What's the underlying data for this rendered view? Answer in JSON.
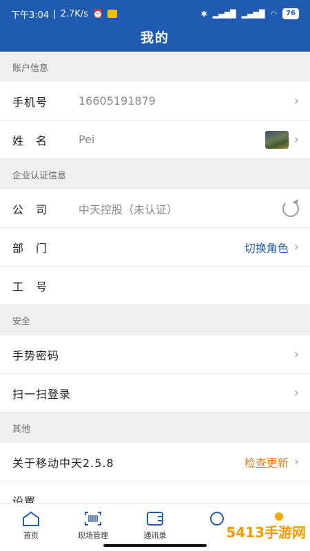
{
  "status_bar": {
    "time": "下午3:04",
    "speed": "2.7K/s",
    "battery": "76"
  },
  "header": {
    "title": "我的"
  },
  "sections": {
    "account": {
      "title": "账户信息",
      "phone_label": "手机号",
      "phone_value": "16605191879",
      "name_label": "姓　名",
      "name_value": "Pei"
    },
    "company": {
      "title": "企业认证信息",
      "company_label": "公　司",
      "company_value": "中天控股（未认证）",
      "dept_label": "部　门",
      "switch_role": "切换角色",
      "employee_label": "工　号"
    },
    "security": {
      "title": "安全",
      "gesture_password": "手势密码",
      "scan_login": "扫一扫登录"
    },
    "other": {
      "title": "其他",
      "about": "关于移动中天2.5.8",
      "check_update": "检查更新",
      "settings": "设置"
    }
  },
  "tabbar": {
    "home": "首页",
    "site_mgmt": "现场管理",
    "contacts": "通讯录"
  },
  "watermark": "5413手游网",
  "colors": {
    "primary": "#1f5bb0",
    "accent": "#e07b1a"
  }
}
